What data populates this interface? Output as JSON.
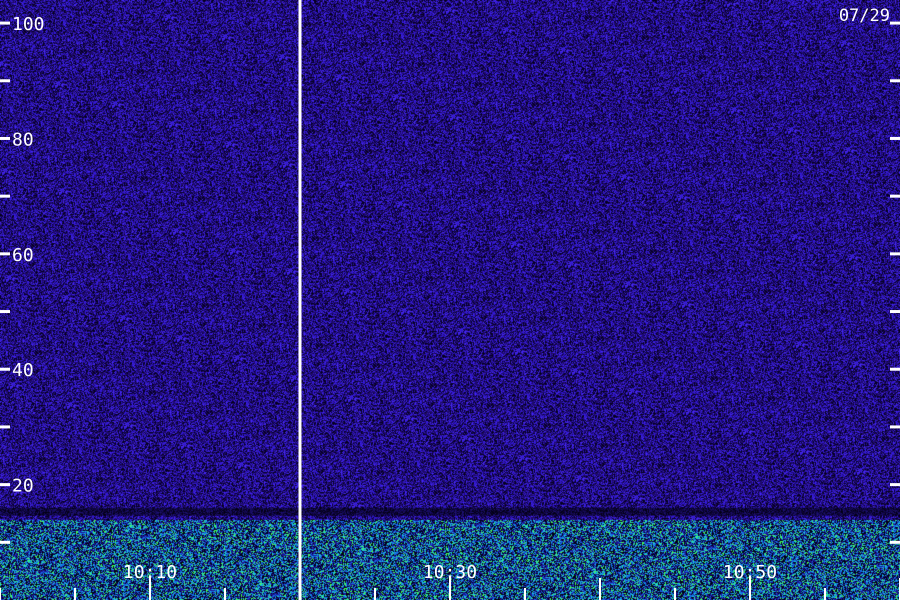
{
  "date_label": "07/29",
  "chart_data": {
    "type": "heatmap",
    "title": "",
    "xlabel": "",
    "ylabel": "",
    "ylim": [
      0,
      104
    ],
    "y_ticks": [
      {
        "value": 10,
        "label": ""
      },
      {
        "value": 20,
        "label": "20"
      },
      {
        "value": 30,
        "label": ""
      },
      {
        "value": 40,
        "label": "40"
      },
      {
        "value": 50,
        "label": ""
      },
      {
        "value": 60,
        "label": "60"
      },
      {
        "value": 70,
        "label": ""
      },
      {
        "value": 80,
        "label": "80"
      },
      {
        "value": 90,
        "label": ""
      },
      {
        "value": 100,
        "label": "100"
      }
    ],
    "x_range_minutes": [
      "10:00",
      "11:00"
    ],
    "x_ticks": [
      {
        "time": "10:00",
        "label": "",
        "major": false
      },
      {
        "time": "10:05",
        "label": "",
        "major": false
      },
      {
        "time": "10:10",
        "label": "10:10",
        "major": true
      },
      {
        "time": "10:15",
        "label": "",
        "major": false
      },
      {
        "time": "10:20",
        "label": "",
        "major": true
      },
      {
        "time": "10:25",
        "label": "",
        "major": false
      },
      {
        "time": "10:30",
        "label": "10:30",
        "major": true
      },
      {
        "time": "10:35",
        "label": "",
        "major": false
      },
      {
        "time": "10:40",
        "label": "",
        "major": true
      },
      {
        "time": "10:45",
        "label": "",
        "major": false
      },
      {
        "time": "10:50",
        "label": "10:50",
        "major": true
      },
      {
        "time": "10:55",
        "label": "",
        "major": false
      },
      {
        "time": "11:00",
        "label": "",
        "major": true
      }
    ],
    "gap_marker_time": "10:20",
    "colorscale": [
      "#000000",
      "#1a0a5c",
      "#3020c0",
      "#2080ff",
      "#20e0e0",
      "#40ff60"
    ]
  }
}
